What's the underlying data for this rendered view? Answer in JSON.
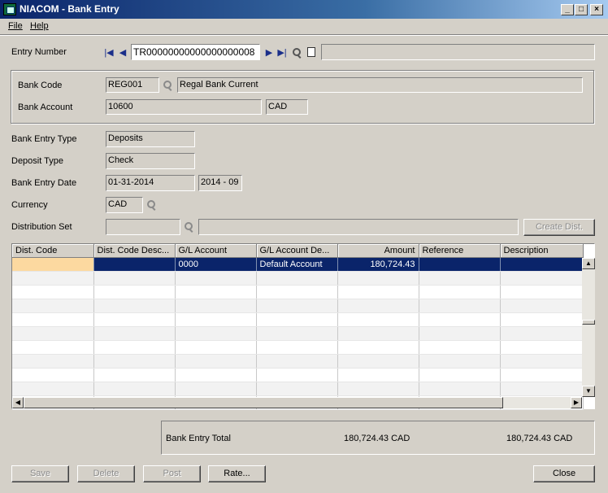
{
  "window": {
    "title": "NIACOM - Bank Entry",
    "buttons": {
      "minimize": "_",
      "maximize": "□",
      "close": "×"
    }
  },
  "menu": {
    "file": "File",
    "help": "Help"
  },
  "entry": {
    "label": "Entry Number",
    "value": "TR00000000000000000008",
    "description": ""
  },
  "bank": {
    "code_label": "Bank Code",
    "code": "REG001",
    "name": "Regal Bank Current",
    "account_label": "Bank Account",
    "account": "10600",
    "currency": "CAD"
  },
  "fields": {
    "entry_type_label": "Bank Entry Type",
    "entry_type": "Deposits",
    "deposit_type_label": "Deposit Type",
    "deposit_type": "Check",
    "entry_date_label": "Bank Entry Date",
    "entry_date": "01-31-2014",
    "period": "2014 - 09",
    "currency_label": "Currency",
    "currency": "CAD",
    "dist_set_label": "Distribution Set",
    "dist_set": "",
    "dist_set_desc": "",
    "create_dist": "Create Dist."
  },
  "grid": {
    "columns": [
      "Dist. Code",
      "Dist. Code Desc...",
      "G/L Account",
      "G/L Account De...",
      "Amount",
      "Reference",
      "Description"
    ],
    "rows": [
      [
        "",
        "",
        "0000",
        "Default Account",
        "180,724.43",
        "",
        ""
      ]
    ],
    "empty_rows": 10
  },
  "totals": {
    "label": "Bank Entry Total",
    "amount1": "180,724.43 CAD",
    "amount2": "180,724.43 CAD"
  },
  "buttons": {
    "save": "Save",
    "delete": "Delete",
    "post": "Post",
    "rate": "Rate...",
    "close": "Close"
  }
}
